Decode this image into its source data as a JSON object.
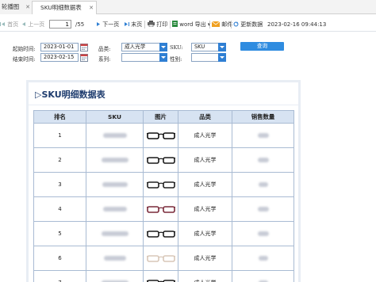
{
  "tabs": [
    {
      "label": "轮播图",
      "close": "✕"
    },
    {
      "label": "SKU明细数据表",
      "close": "✕"
    }
  ],
  "toolbar": {
    "first": "首页",
    "prev": "上一页",
    "page_value": "1",
    "page_total": "/55",
    "next": "下一页",
    "last": "末页",
    "print": "打印",
    "word_export": "word 导出",
    "mail": "邮件",
    "refresh": "更新数据",
    "timestamp": "2023-02-16 09:44:13"
  },
  "filters": {
    "start_label": "起始时间:",
    "start_value": "2023-01-01",
    "end_label": "结束时间:",
    "end_value": "2023-02-15",
    "category_label": "品类:",
    "category_value": "成人光学",
    "series_label": "系列:",
    "series_value": "",
    "sku_label": "SKU:",
    "sku_value": "SKU",
    "gender_label": "性别:",
    "gender_value": "",
    "query_button": "查询"
  },
  "report": {
    "title": "▷SKU明细数据表",
    "columns": [
      "排名",
      "SKU",
      "图片",
      "品类",
      "销售数量"
    ],
    "rows": [
      {
        "rank": "1",
        "category": "成人光学",
        "frame_color": "#111111"
      },
      {
        "rank": "2",
        "category": "成人光学",
        "frame_color": "#1a1a1a"
      },
      {
        "rank": "3",
        "category": "成人光学",
        "frame_color": "#222222"
      },
      {
        "rank": "4",
        "category": "成人光学",
        "frame_color": "#7a2a3a"
      },
      {
        "rank": "5",
        "category": "成人光学",
        "frame_color": "#1c1c1c"
      },
      {
        "rank": "6",
        "category": "成人光学",
        "frame_color": "#d8c7b8"
      },
      {
        "rank": "7",
        "category": "成人光学",
        "frame_color": "#1a1a1a"
      }
    ]
  },
  "colors": {
    "accent": "#2f8ce0",
    "title": "#1e3c6e",
    "header_bg": "#d7e3f2"
  }
}
